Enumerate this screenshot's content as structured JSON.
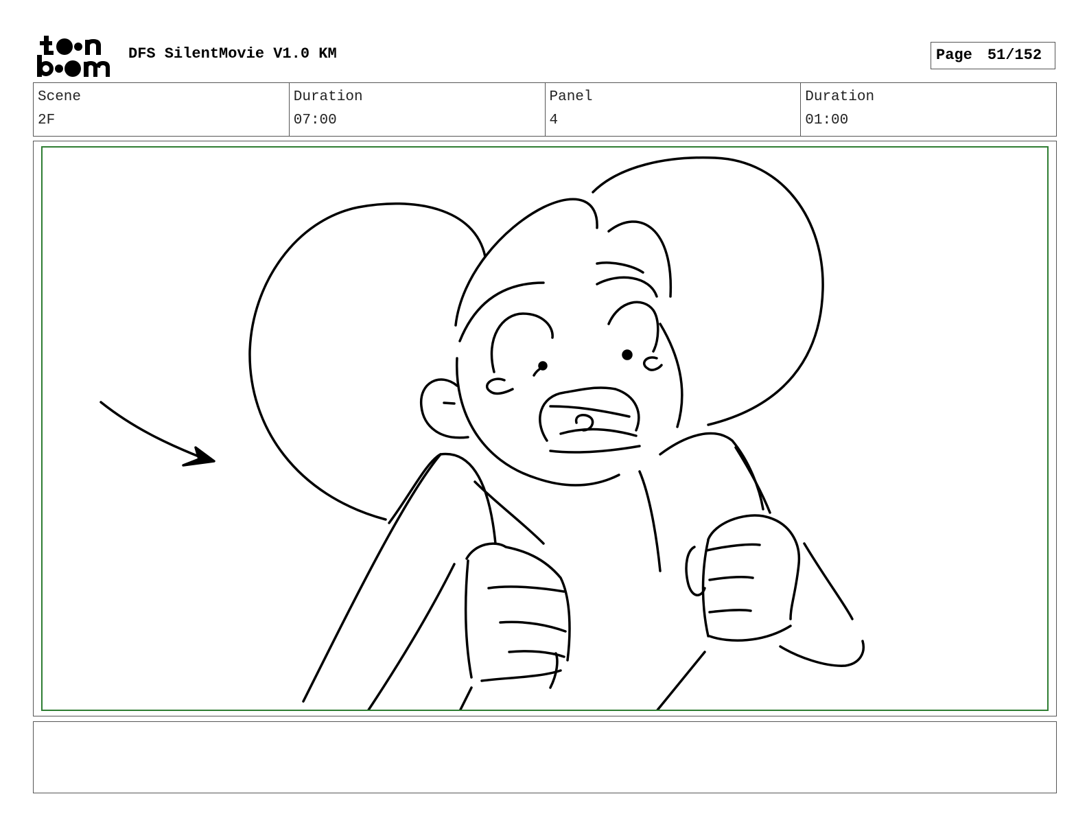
{
  "header": {
    "logo_text": "toon boom",
    "project_title": "DFS SilentMovie V1.0 KM",
    "page_label": "Page",
    "page_number": "51/152"
  },
  "info": {
    "scene_label": "Scene",
    "scene_value": "2F",
    "scene_duration_label": "Duration",
    "scene_duration_value": "07:00",
    "panel_label": "Panel",
    "panel_value": "4",
    "panel_duration_label": "Duration",
    "panel_duration_value": "01:00"
  },
  "notes": {
    "text": ""
  },
  "colors": {
    "safe_frame": "#2e7d32",
    "border": "#555555",
    "ink": "#000000"
  }
}
